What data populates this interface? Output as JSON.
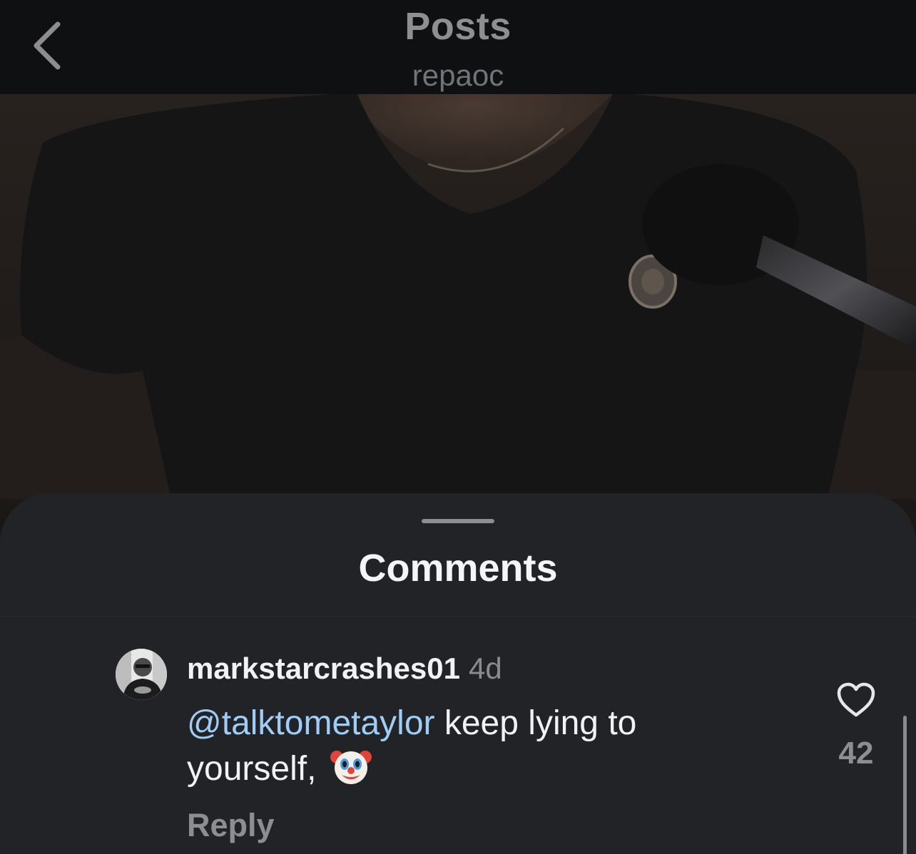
{
  "nav": {
    "title": "Posts",
    "subtitle": "repaoc",
    "back_icon": "chevron-left-icon"
  },
  "sheet": {
    "title": "Comments"
  },
  "comment": {
    "author": "markstarcrashes01",
    "time": "4d",
    "mention": "@talktometaylor",
    "text_part1": " keep lying to yourself,",
    "emoji": "clown-face-icon",
    "reply_label": "Reply",
    "like_icon": "heart-outline-icon",
    "like_count": "42"
  },
  "colors": {
    "nav_background": "#0f1012",
    "sheet_background": "#222327",
    "mention": "#9fcdf6",
    "secondary_text": "#8d8e92"
  }
}
